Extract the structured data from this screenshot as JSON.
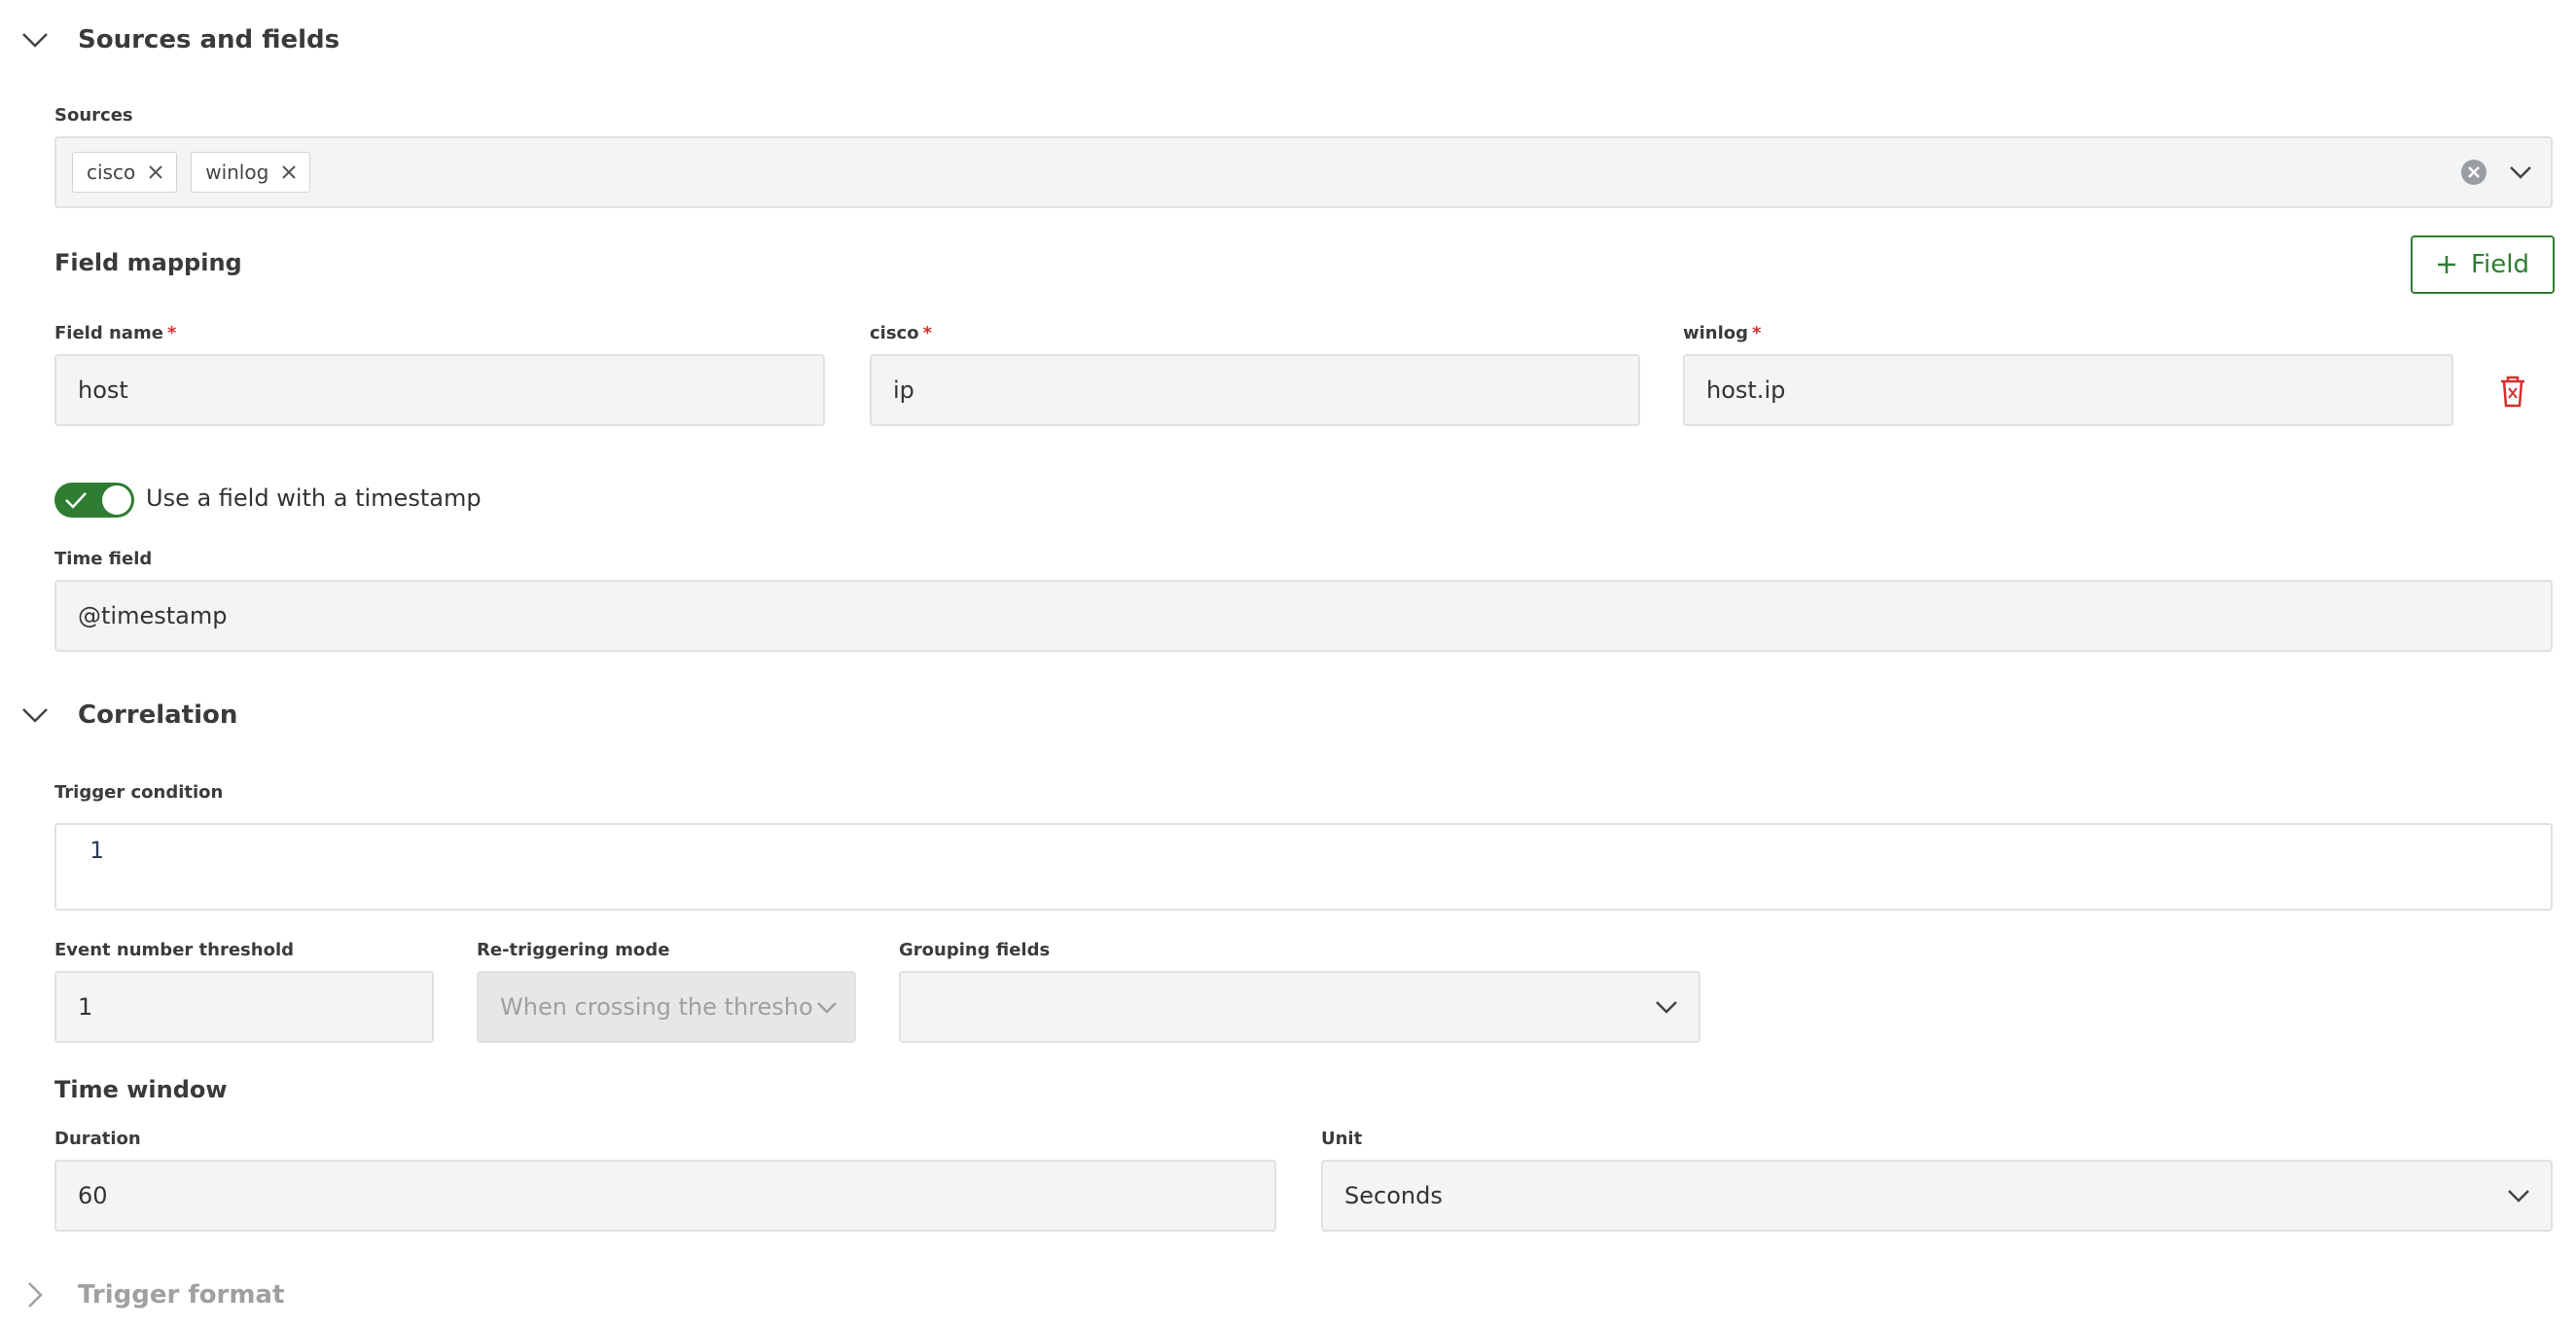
{
  "sources_section": {
    "title": "Sources and fields",
    "sources_label": "Sources",
    "chips": [
      {
        "label": "cisco"
      },
      {
        "label": "winlog"
      }
    ]
  },
  "field_mapping": {
    "title": "Field mapping",
    "add_button_label": "Field",
    "columns": [
      {
        "label": "Field name",
        "value": "host"
      },
      {
        "label": "cisco",
        "value": "ip"
      },
      {
        "label": "winlog",
        "value": "host.ip"
      }
    ],
    "required_mark": "*"
  },
  "timestamp": {
    "toggle_label": "Use a field with a timestamp",
    "toggle_on": true,
    "time_field_label": "Time field",
    "time_field_value": "@timestamp"
  },
  "correlation": {
    "title": "Correlation",
    "trigger_condition_label": "Trigger condition",
    "trigger_condition_line": "1",
    "event_threshold_label": "Event number threshold",
    "event_threshold_value": "1",
    "retrigger_label": "Re-triggering mode",
    "retrigger_value": "When crossing the threshold",
    "grouping_label": "Grouping fields",
    "grouping_value": "",
    "time_window_title": "Time window",
    "duration_label": "Duration",
    "duration_value": "60",
    "unit_label": "Unit",
    "unit_value": "Seconds"
  },
  "trigger_format": {
    "title": "Trigger format"
  },
  "colors": {
    "accent_green": "#2e7d32",
    "danger_red": "#d32f2f"
  }
}
